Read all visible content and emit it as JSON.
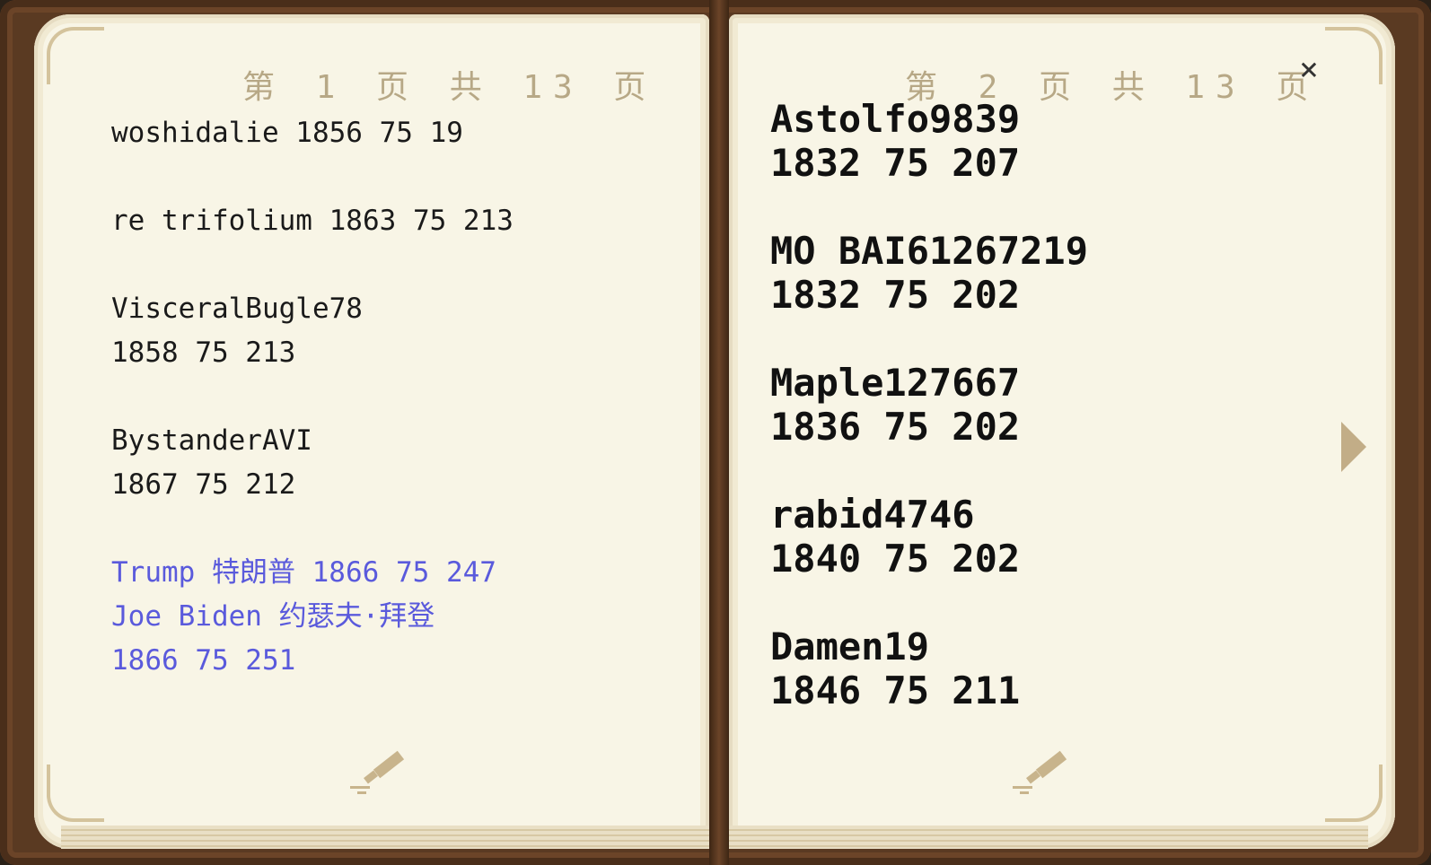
{
  "left_page": {
    "header": "第 1 页 共 13 页",
    "entries": [
      {
        "text": "woshidalie 1856 75 19",
        "color": "normal"
      },
      {
        "text": "",
        "color": "gap"
      },
      {
        "text": "re trifolium 1863 75 213",
        "color": "normal"
      },
      {
        "text": "",
        "color": "gap"
      },
      {
        "text": "VisceralBugle78",
        "color": "normal"
      },
      {
        "text": "1858 75 213",
        "color": "normal"
      },
      {
        "text": "",
        "color": "gap"
      },
      {
        "text": "BystanderAVI",
        "color": "normal"
      },
      {
        "text": "1867 75 212",
        "color": "normal"
      },
      {
        "text": "",
        "color": "gap"
      },
      {
        "text": "Trump 特朗普 1866 75 247",
        "color": "blue"
      },
      {
        "text": "Joe Biden 约瑟夫·拜登",
        "color": "blue"
      },
      {
        "text": "1866 75 251",
        "color": "blue"
      }
    ]
  },
  "right_page": {
    "header": "第 2 页 共 13 页",
    "entries": [
      {
        "text": "Astolfo9839",
        "color": "normal"
      },
      {
        "text": "1832 75 207",
        "color": "normal"
      },
      {
        "text": "",
        "color": "gap"
      },
      {
        "text": "MO BAI61267219",
        "color": "normal"
      },
      {
        "text": "1832 75 202",
        "color": "normal"
      },
      {
        "text": "",
        "color": "gap"
      },
      {
        "text": "Maple127667",
        "color": "normal"
      },
      {
        "text": "1836 75 202",
        "color": "normal"
      },
      {
        "text": "",
        "color": "gap"
      },
      {
        "text": "rabid4746",
        "color": "normal"
      },
      {
        "text": "1840 75 202",
        "color": "normal"
      },
      {
        "text": "",
        "color": "gap"
      },
      {
        "text": "Damen19",
        "color": "normal"
      },
      {
        "text": "1846 75 211",
        "color": "normal"
      }
    ]
  },
  "controls": {
    "close_symbol": "×",
    "close_icon": "close-icon",
    "next_icon": "next-page-arrow-icon",
    "edit_icon": "quill-pen-icon"
  },
  "colors": {
    "blue_text": "#5a5adc",
    "header_text": "#b7a886",
    "paper": "#f8f5e6"
  }
}
